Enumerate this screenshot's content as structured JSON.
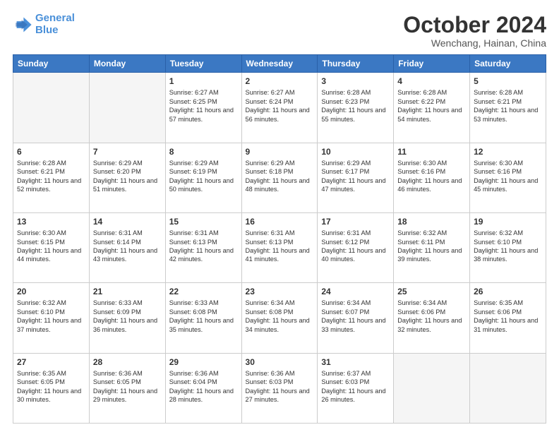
{
  "header": {
    "logo_line1": "General",
    "logo_line2": "Blue",
    "month": "October 2024",
    "location": "Wenchang, Hainan, China"
  },
  "weekdays": [
    "Sunday",
    "Monday",
    "Tuesday",
    "Wednesday",
    "Thursday",
    "Friday",
    "Saturday"
  ],
  "weeks": [
    [
      {
        "day": "",
        "empty": true
      },
      {
        "day": "",
        "empty": true
      },
      {
        "day": "1",
        "sunrise": "6:27 AM",
        "sunset": "6:25 PM",
        "daylight": "11 hours and 57 minutes."
      },
      {
        "day": "2",
        "sunrise": "6:27 AM",
        "sunset": "6:24 PM",
        "daylight": "11 hours and 56 minutes."
      },
      {
        "day": "3",
        "sunrise": "6:28 AM",
        "sunset": "6:23 PM",
        "daylight": "11 hours and 55 minutes."
      },
      {
        "day": "4",
        "sunrise": "6:28 AM",
        "sunset": "6:22 PM",
        "daylight": "11 hours and 54 minutes."
      },
      {
        "day": "5",
        "sunrise": "6:28 AM",
        "sunset": "6:21 PM",
        "daylight": "11 hours and 53 minutes."
      }
    ],
    [
      {
        "day": "6",
        "sunrise": "6:28 AM",
        "sunset": "6:21 PM",
        "daylight": "11 hours and 52 minutes."
      },
      {
        "day": "7",
        "sunrise": "6:29 AM",
        "sunset": "6:20 PM",
        "daylight": "11 hours and 51 minutes."
      },
      {
        "day": "8",
        "sunrise": "6:29 AM",
        "sunset": "6:19 PM",
        "daylight": "11 hours and 50 minutes."
      },
      {
        "day": "9",
        "sunrise": "6:29 AM",
        "sunset": "6:18 PM",
        "daylight": "11 hours and 48 minutes."
      },
      {
        "day": "10",
        "sunrise": "6:29 AM",
        "sunset": "6:17 PM",
        "daylight": "11 hours and 47 minutes."
      },
      {
        "day": "11",
        "sunrise": "6:30 AM",
        "sunset": "6:16 PM",
        "daylight": "11 hours and 46 minutes."
      },
      {
        "day": "12",
        "sunrise": "6:30 AM",
        "sunset": "6:16 PM",
        "daylight": "11 hours and 45 minutes."
      }
    ],
    [
      {
        "day": "13",
        "sunrise": "6:30 AM",
        "sunset": "6:15 PM",
        "daylight": "11 hours and 44 minutes."
      },
      {
        "day": "14",
        "sunrise": "6:31 AM",
        "sunset": "6:14 PM",
        "daylight": "11 hours and 43 minutes."
      },
      {
        "day": "15",
        "sunrise": "6:31 AM",
        "sunset": "6:13 PM",
        "daylight": "11 hours and 42 minutes."
      },
      {
        "day": "16",
        "sunrise": "6:31 AM",
        "sunset": "6:13 PM",
        "daylight": "11 hours and 41 minutes."
      },
      {
        "day": "17",
        "sunrise": "6:31 AM",
        "sunset": "6:12 PM",
        "daylight": "11 hours and 40 minutes."
      },
      {
        "day": "18",
        "sunrise": "6:32 AM",
        "sunset": "6:11 PM",
        "daylight": "11 hours and 39 minutes."
      },
      {
        "day": "19",
        "sunrise": "6:32 AM",
        "sunset": "6:10 PM",
        "daylight": "11 hours and 38 minutes."
      }
    ],
    [
      {
        "day": "20",
        "sunrise": "6:32 AM",
        "sunset": "6:10 PM",
        "daylight": "11 hours and 37 minutes."
      },
      {
        "day": "21",
        "sunrise": "6:33 AM",
        "sunset": "6:09 PM",
        "daylight": "11 hours and 36 minutes."
      },
      {
        "day": "22",
        "sunrise": "6:33 AM",
        "sunset": "6:08 PM",
        "daylight": "11 hours and 35 minutes."
      },
      {
        "day": "23",
        "sunrise": "6:34 AM",
        "sunset": "6:08 PM",
        "daylight": "11 hours and 34 minutes."
      },
      {
        "day": "24",
        "sunrise": "6:34 AM",
        "sunset": "6:07 PM",
        "daylight": "11 hours and 33 minutes."
      },
      {
        "day": "25",
        "sunrise": "6:34 AM",
        "sunset": "6:06 PM",
        "daylight": "11 hours and 32 minutes."
      },
      {
        "day": "26",
        "sunrise": "6:35 AM",
        "sunset": "6:06 PM",
        "daylight": "11 hours and 31 minutes."
      }
    ],
    [
      {
        "day": "27",
        "sunrise": "6:35 AM",
        "sunset": "6:05 PM",
        "daylight": "11 hours and 30 minutes."
      },
      {
        "day": "28",
        "sunrise": "6:36 AM",
        "sunset": "6:05 PM",
        "daylight": "11 hours and 29 minutes."
      },
      {
        "day": "29",
        "sunrise": "6:36 AM",
        "sunset": "6:04 PM",
        "daylight": "11 hours and 28 minutes."
      },
      {
        "day": "30",
        "sunrise": "6:36 AM",
        "sunset": "6:03 PM",
        "daylight": "11 hours and 27 minutes."
      },
      {
        "day": "31",
        "sunrise": "6:37 AM",
        "sunset": "6:03 PM",
        "daylight": "11 hours and 26 minutes."
      },
      {
        "day": "",
        "empty": true
      },
      {
        "day": "",
        "empty": true
      }
    ]
  ]
}
